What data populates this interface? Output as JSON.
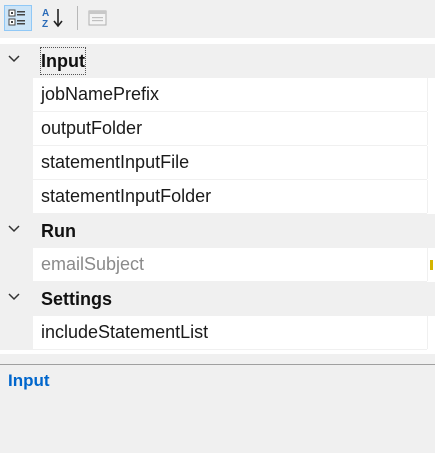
{
  "toolbar": {
    "buttons": [
      {
        "name": "categorized-view-button",
        "icon": "categorized-icon",
        "active": true
      },
      {
        "name": "alphabetical-sort-button",
        "icon": "sort-az-icon",
        "active": false
      },
      {
        "name": "property-pages-button",
        "icon": "property-pages-icon",
        "active": false,
        "disabled": true
      }
    ]
  },
  "grid": {
    "categories": [
      {
        "label": "Input",
        "expanded": true,
        "properties": [
          "jobNamePrefix",
          "outputFolder",
          "statementInputFile",
          "statementInputFolder"
        ]
      },
      {
        "label": "Run",
        "expanded": true,
        "properties": [
          "emailSubject"
        ]
      },
      {
        "label": "Settings",
        "expanded": true,
        "properties": [
          "includeStatementList"
        ]
      }
    ],
    "selected_category": "Input"
  },
  "description": {
    "title": "Input"
  },
  "colors": {
    "accent": "#0066cc",
    "panel": "#f0f0f0",
    "readonly_text": "#8a8a8a"
  }
}
